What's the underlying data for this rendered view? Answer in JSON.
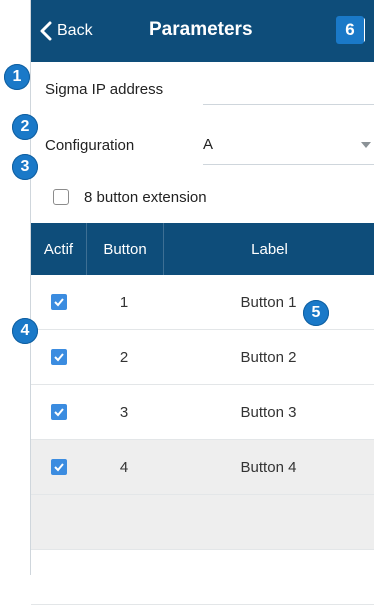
{
  "nav": {
    "back_label": "Back",
    "title": "Parameters"
  },
  "form": {
    "ip_label": "Sigma IP address",
    "ip_value": "",
    "config_label": "Configuration",
    "config_value": "A",
    "extension_label": "8 button extension",
    "extension_checked": false
  },
  "table": {
    "headers": [
      "Actif",
      "Button",
      "Label"
    ],
    "rows": [
      {
        "actif": true,
        "button": "1",
        "label": "Button 1"
      },
      {
        "actif": true,
        "button": "2",
        "label": "Button 2"
      },
      {
        "actif": true,
        "button": "3",
        "label": "Button 3"
      },
      {
        "actif": true,
        "button": "4",
        "label": "Button 4"
      }
    ]
  },
  "annotations": [
    "1",
    "2",
    "3",
    "4",
    "5",
    "6"
  ],
  "colors": {
    "header_bg": "#0e4d7a",
    "checkbox_checked": "#3b8ce0",
    "badge": "#1a79c8",
    "row_alt": "#eeeeee"
  }
}
